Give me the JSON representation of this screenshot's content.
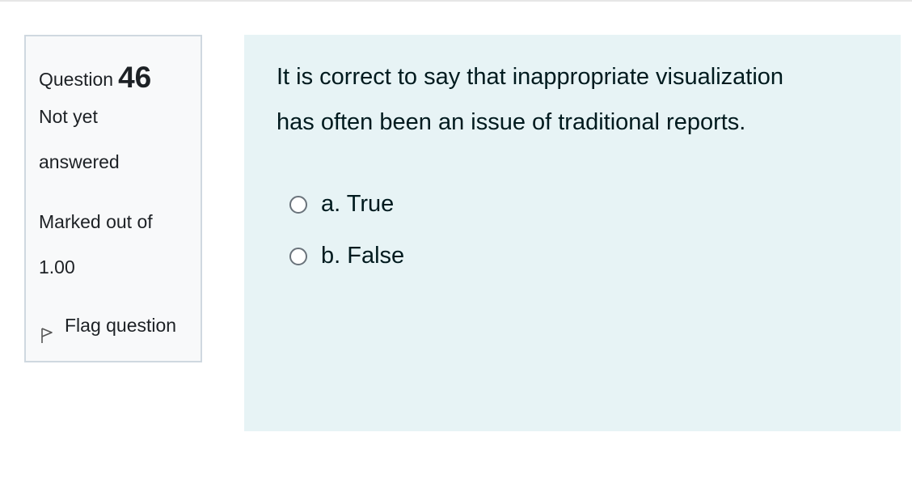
{
  "question": {
    "label": "Question",
    "number": "46",
    "status_line1": "Not yet",
    "status_line2": "answered",
    "marks_line1": "Marked out of",
    "marks_line2": "1.00",
    "flag_label": "Flag question",
    "text_line1": "It is correct to say that inappropriate visualization",
    "text_line2": "has often been an issue of traditional reports."
  },
  "answers": [
    {
      "label": "a. True",
      "selected": false
    },
    {
      "label": "b. False",
      "selected": false
    }
  ],
  "colors": {
    "info_bg": "#f8f9fa",
    "info_border": "#cfd8e0",
    "content_bg": "#e7f3f5",
    "text": "#001a1e"
  }
}
